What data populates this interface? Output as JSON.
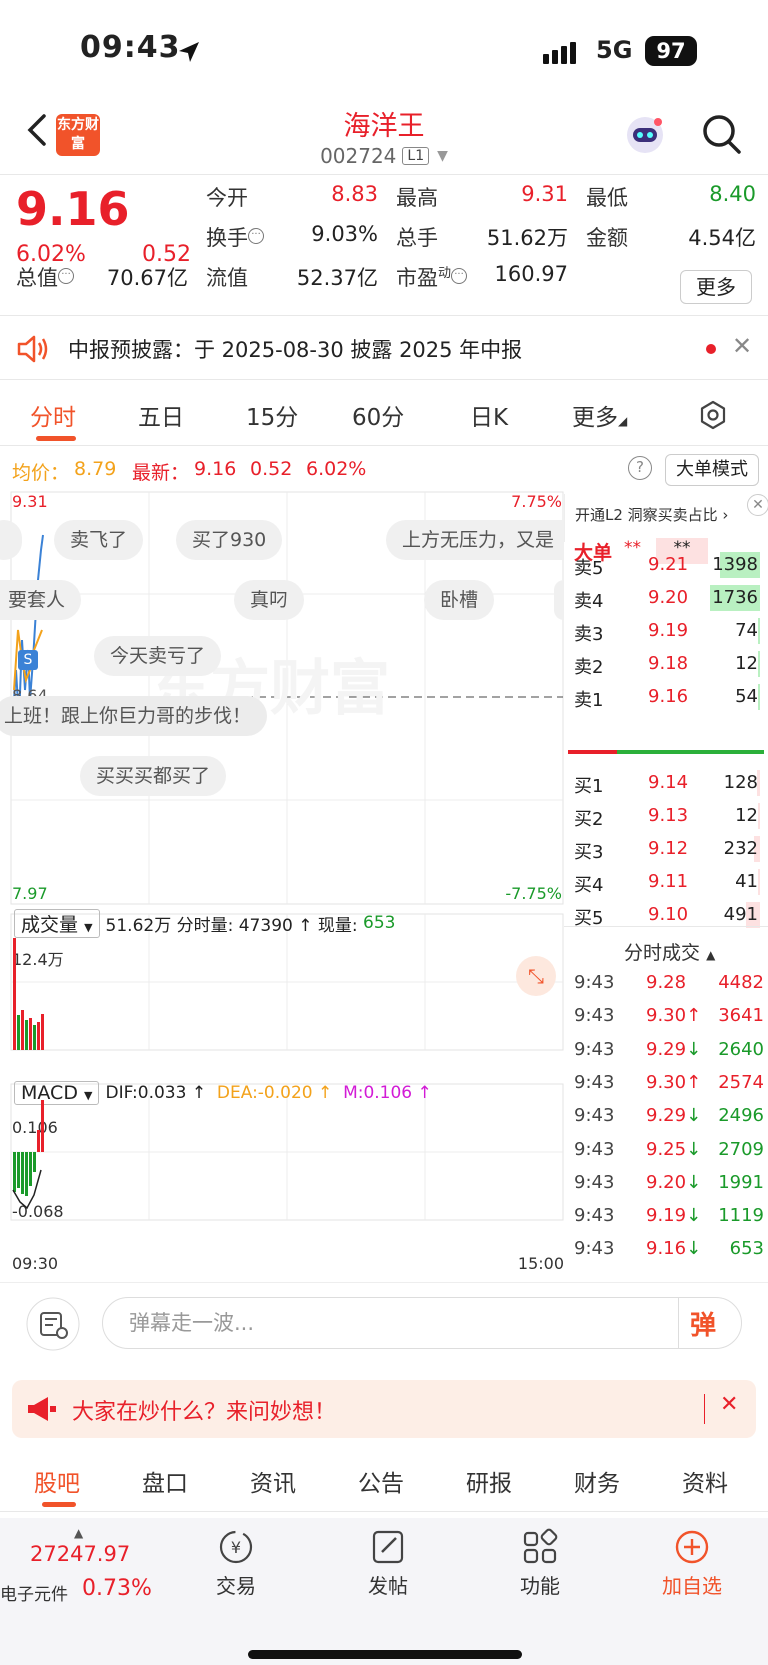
{
  "status": {
    "time": "09:43",
    "network": "5G",
    "battery": "97"
  },
  "header": {
    "stock_name": "海洋王",
    "stock_code": "002724",
    "level": "L1",
    "logo_text": "东方财富"
  },
  "quote": {
    "price": "9.16",
    "pct": "6.02%",
    "change": "0.52",
    "open_label": "今开",
    "open": "8.83",
    "high_label": "最高",
    "high": "9.31",
    "low_label": "最低",
    "low": "8.40",
    "turnover_label": "换手",
    "turnover": "9.03%",
    "volume_label": "总手",
    "volume": "51.62万",
    "amount_label": "金额",
    "amount": "4.54亿",
    "mcap_label": "总值",
    "mcap": "70.67亿",
    "float_label": "流值",
    "float": "52.37亿",
    "pe_label": "市盈",
    "pe_sup": "动",
    "pe": "160.97",
    "more": "更多"
  },
  "notice": {
    "text": "中报预披露：于 2025-08-30 披露 2025 年中报"
  },
  "chart_tabs": [
    "分时",
    "五日",
    "15分",
    "60分",
    "日K",
    "更多"
  ],
  "avg": {
    "avg_label": "均价：",
    "avg": "8.79",
    "latest_label": "最新：",
    "latest": "9.16",
    "chg": "0.52",
    "pct": "6.02%",
    "mode": "大单模式"
  },
  "chart": {
    "y_top": "9.31",
    "y_mid": "8.64",
    "y_bottom": "7.97",
    "pct_top": "7.75%",
    "pct_bottom": "-7.75%",
    "watermark": "东方财富",
    "bubbles": [
      "卖飞了",
      "买了930",
      "上方无压力，又是",
      "要套人",
      "真叼",
      "卧槽",
      "今天卖亏了",
      "上班！跟上你巨力哥的步伐！",
      "买买买都买了"
    ],
    "vol_label": "成交量",
    "vol_total": "51.62万",
    "vol_info": "分时量: 47390 ↑ 现量:",
    "vol_now": "653",
    "vol_max": "12.4万",
    "macd_label": "MACD",
    "dif": "DIF:0.033 ↑",
    "dea": "DEA:-0.020 ↑",
    "m": "M:0.106 ↑",
    "macd_top": "0.106",
    "macd_bottom": "-0.068",
    "t_start": "09:30",
    "t_end": "15:00"
  },
  "book": {
    "promo": "开通L2 洞察买卖占比 ›",
    "big_label": "大单",
    "big_val1": "**",
    "big_val2": "**",
    "asks": [
      {
        "label": "卖5",
        "price": "9.21",
        "vol": "1398",
        "bar": 0.8
      },
      {
        "label": "卖4",
        "price": "9.20",
        "vol": "1736",
        "bar": 1.0
      },
      {
        "label": "卖3",
        "price": "9.19",
        "vol": "74",
        "bar": 0.04
      },
      {
        "label": "卖2",
        "price": "9.18",
        "vol": "12",
        "bar": 0.01
      },
      {
        "label": "卖1",
        "price": "9.16",
        "vol": "54",
        "bar": 0.03
      }
    ],
    "bids": [
      {
        "label": "买1",
        "price": "9.14",
        "vol": "128",
        "bar": 0.07
      },
      {
        "label": "买2",
        "price": "9.13",
        "vol": "12",
        "bar": 0.01
      },
      {
        "label": "买3",
        "price": "9.12",
        "vol": "232",
        "bar": 0.13
      },
      {
        "label": "买4",
        "price": "9.11",
        "vol": "41",
        "bar": 0.02
      },
      {
        "label": "买5",
        "price": "9.10",
        "vol": "491",
        "bar": 0.28
      }
    ],
    "trades_title": "分时成交",
    "trades": [
      {
        "t": "9:43",
        "p": "9.28",
        "v": "4482",
        "dir": "none"
      },
      {
        "t": "9:43",
        "p": "9.30↑",
        "v": "3641",
        "dir": "up"
      },
      {
        "t": "9:43",
        "p": "9.29↓",
        "v": "2640",
        "dir": "down"
      },
      {
        "t": "9:43",
        "p": "9.30↑",
        "v": "2574",
        "dir": "up"
      },
      {
        "t": "9:43",
        "p": "9.29↓",
        "v": "2496",
        "dir": "down"
      },
      {
        "t": "9:43",
        "p": "9.25↓",
        "v": "2709",
        "dir": "down"
      },
      {
        "t": "9:43",
        "p": "9.20↓",
        "v": "1991",
        "dir": "down"
      },
      {
        "t": "9:43",
        "p": "9.19↓",
        "v": "1119",
        "dir": "down"
      },
      {
        "t": "9:43",
        "p": "9.16↓",
        "v": "653",
        "dir": "down"
      }
    ]
  },
  "comment": {
    "placeholder": "弹幕走一波...",
    "danmu": "弹"
  },
  "promo": {
    "text": "大家在炒什么？来问妙想！"
  },
  "bottom_tabs": [
    "股吧",
    "盘口",
    "资讯",
    "公告",
    "研报",
    "财务",
    "资料"
  ],
  "nav": {
    "index_value": "27247.97",
    "index_name": "电子元件",
    "index_pct": "0.73%",
    "trade": "交易",
    "post": "发帖",
    "func": "功能",
    "watch": "加自选"
  },
  "colors": {
    "up": "#e8202a",
    "down": "#1a9a2a",
    "accent": "#f1532a"
  }
}
